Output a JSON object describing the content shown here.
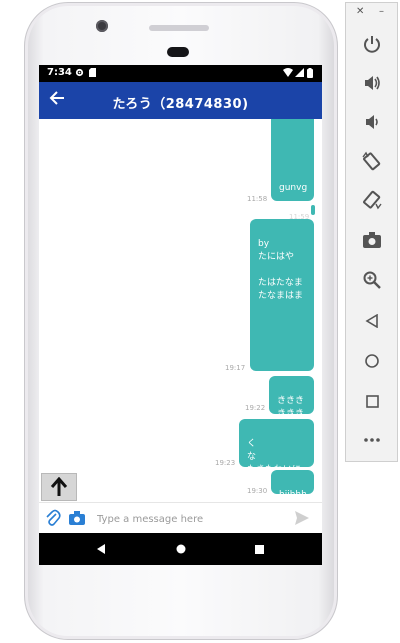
{
  "status_bar": {
    "time": "7:34"
  },
  "app_bar": {
    "title": "たろう（28474830)"
  },
  "messages": [
    {
      "text": "gunvg",
      "time": "11:58"
    },
    {
      "text": "",
      "time": "11:59"
    },
    {
      "text": "by\nたにはや\n\nたはたなま\nたなまはま",
      "time": "19:17"
    },
    {
      "text": "ききき\nききき",
      "time": "19:22"
    },
    {
      "text": "く\nな\nたきたわいに",
      "time": "19:23"
    },
    {
      "text": "hjjhhh",
      "time": "19:30"
    }
  ],
  "composer": {
    "placeholder": "Type a message here",
    "value": ""
  },
  "toolbar": {
    "close": "✕",
    "minimize": "–",
    "items": [
      "power-icon",
      "volume-up-icon",
      "volume-down-icon",
      "rotate-left-icon",
      "rotate-right-icon",
      "screenshot-camera-icon",
      "zoom-icon",
      "back-icon",
      "home-icon",
      "overview-icon",
      "more-icon"
    ]
  },
  "colors": {
    "accent": "#1b44a8",
    "bubble": "#3fb8b3"
  }
}
